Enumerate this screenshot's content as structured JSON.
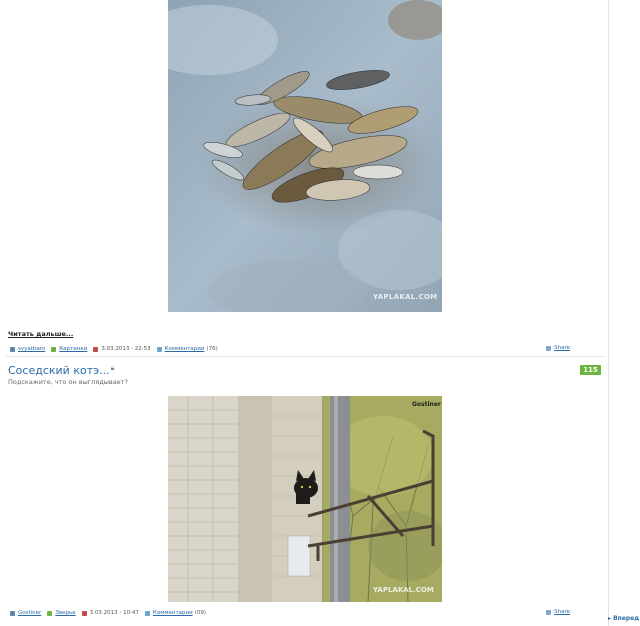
{
  "post1": {
    "read_more": "Читать дальше...",
    "author": "svyatbaro",
    "category": "Картинки",
    "datetime": "3.03.2013 - 22:53",
    "comments_label": "Комментарии",
    "comments_count": "(76)",
    "share": "Share",
    "image_watermark": "YAPLAKAL.COM"
  },
  "post2": {
    "title": "Соседский котэ...",
    "subtitle": "Подскажите, что он выглядывает?",
    "rating": "115",
    "image_signature": "Gostiner",
    "image_watermark": "YAPLAKAL.COM",
    "author": "Gostiner",
    "category": "Зверье",
    "datetime": "3.03.2013 - 10:47",
    "comments_label": "Комментарии",
    "comments_count": "(09)",
    "share": "Share"
  },
  "pager": {
    "more": "Вперед"
  },
  "colors": {
    "link": "#2a6aa6",
    "rating_bg": "#6db33f"
  }
}
